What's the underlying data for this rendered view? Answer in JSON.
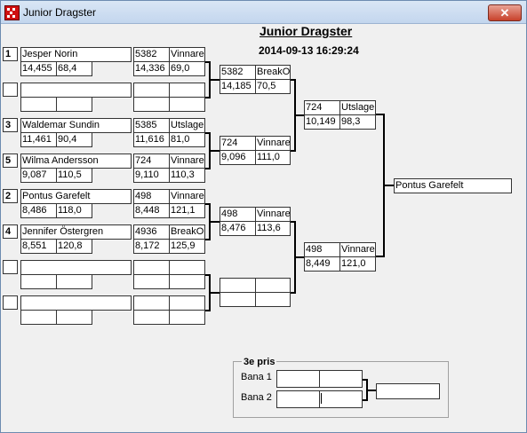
{
  "window": {
    "title": "Junior Dragster",
    "close_label": "✕"
  },
  "header": {
    "title": "Junior Dragster",
    "datetime": "2014-09-13 16:29:24"
  },
  "round1": [
    {
      "seed": "1",
      "name": "Jesper Norin",
      "rt": "14,455",
      "speed": "68,4",
      "num": "5382",
      "result": "Vinnare",
      "et": "14,336",
      "sp2": "69,0"
    },
    {
      "seed": "",
      "name": "",
      "rt": "",
      "speed": "",
      "num": "",
      "result": "",
      "et": "",
      "sp2": ""
    },
    {
      "seed": "3",
      "name": "Waldemar Sundin",
      "rt": "11,461",
      "speed": "90,4",
      "num": "5385",
      "result": "Utslagen",
      "et": "11,616",
      "sp2": "81,0"
    },
    {
      "seed": "5",
      "name": "Wilma Andersson",
      "rt": "9,087",
      "speed": "110,5",
      "num": "724",
      "result": "Vinnare",
      "et": "9,110",
      "sp2": "110,3"
    },
    {
      "seed": "2",
      "name": "Pontus Garefelt",
      "rt": "8,486",
      "speed": "118,0",
      "num": "498",
      "result": "Vinnare",
      "et": "8,448",
      "sp2": "121,1"
    },
    {
      "seed": "4",
      "name": "Jennifer Östergren",
      "rt": "8,551",
      "speed": "120,8",
      "num": "4936",
      "result": "BreakOut",
      "et": "8,172",
      "sp2": "125,9"
    },
    {
      "seed": "",
      "name": "",
      "rt": "",
      "speed": "",
      "num": "",
      "result": "",
      "et": "",
      "sp2": ""
    },
    {
      "seed": "",
      "name": "",
      "rt": "",
      "speed": "",
      "num": "",
      "result": "",
      "et": "",
      "sp2": ""
    }
  ],
  "round2": [
    {
      "num": "5382",
      "result": "BreakOut",
      "et": "14,185",
      "sp": "70,5"
    },
    {
      "num": "724",
      "result": "Vinnare",
      "et": "9,096",
      "sp": "111,0"
    },
    {
      "num": "498",
      "result": "Vinnare",
      "et": "8,476",
      "sp": "113,6"
    },
    {
      "num": "",
      "result": "",
      "et": "",
      "sp": ""
    }
  ],
  "round3": [
    {
      "num": "724",
      "result": "Utslagen",
      "et": "10,149",
      "sp": "98,3"
    },
    {
      "num": "498",
      "result": "Vinnare",
      "et": "8,449",
      "sp": "121,0"
    }
  ],
  "winner": "Pontus Garefelt",
  "third_place": {
    "title": "3e pris",
    "lane1": "Bana 1",
    "lane2": "Bana 2"
  }
}
